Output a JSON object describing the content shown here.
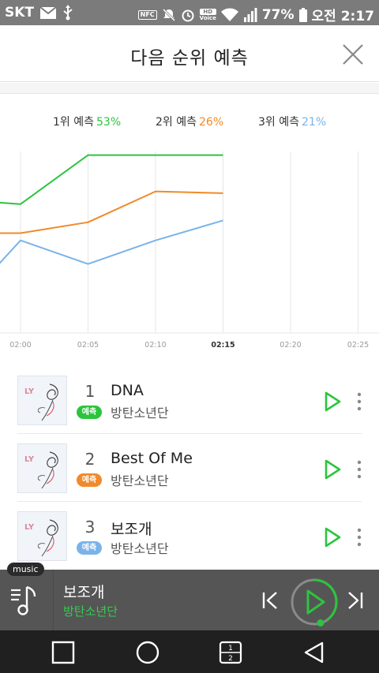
{
  "status_bar": {
    "carrier": "SKT",
    "battery": "77%",
    "time": "오전 2:17",
    "nfc": "NFC",
    "hd": "HD",
    "voice": "Voice"
  },
  "header": {
    "title": "다음 순위 예측"
  },
  "legend": [
    {
      "label": "1위 예측",
      "percent": "53%",
      "color": "#2bc53d"
    },
    {
      "label": "2위 예측",
      "percent": "26%",
      "color": "#f08a2a"
    },
    {
      "label": "3위 예측",
      "percent": "21%",
      "color": "#7ab3ea"
    }
  ],
  "chart_data": {
    "type": "line",
    "x": [
      "02:00",
      "02:05",
      "02:10",
      "02:15",
      "02:20",
      "02:25"
    ],
    "current_tick": "02:15",
    "y_range": [
      0,
      1
    ],
    "grid": true,
    "series": [
      {
        "color": "#2bc53d",
        "points": [
          [
            -1.5,
            0.75
          ],
          [
            0,
            0.71
          ],
          [
            1,
            0.98
          ],
          [
            2,
            0.98
          ],
          [
            3,
            0.98
          ]
        ]
      },
      {
        "color": "#f08a2a",
        "points": [
          [
            -1.5,
            0.55
          ],
          [
            0,
            0.55
          ],
          [
            1,
            0.61
          ],
          [
            2,
            0.78
          ],
          [
            3,
            0.77
          ]
        ]
      },
      {
        "color": "#7ab3ea",
        "points": [
          [
            -1.5,
            -0.1
          ],
          [
            0,
            0.51
          ],
          [
            1,
            0.38
          ],
          [
            2,
            0.51
          ],
          [
            3,
            0.62
          ]
        ]
      }
    ]
  },
  "songs": [
    {
      "rank": "1",
      "title": "DNA",
      "artist": "방탄소년단",
      "badge": "예측",
      "badge_color": "#2bc53d"
    },
    {
      "rank": "2",
      "title": "Best Of Me",
      "artist": "방탄소년단",
      "badge": "예측",
      "badge_color": "#f08a2a"
    },
    {
      "rank": "3",
      "title": "보조개",
      "artist": "방탄소년단",
      "badge": "예측",
      "badge_color": "#7ab3ea"
    }
  ],
  "album_art_text": "LY",
  "player": {
    "tag": "music",
    "title": "보조개",
    "artist": "방탄소년단"
  },
  "nav": {
    "recent_label_top": "1",
    "recent_label_bottom": "2"
  },
  "colors": {
    "accent_green": "#2bc53d",
    "player_bg": "#555555",
    "status_bg": "#7b7b7b"
  }
}
